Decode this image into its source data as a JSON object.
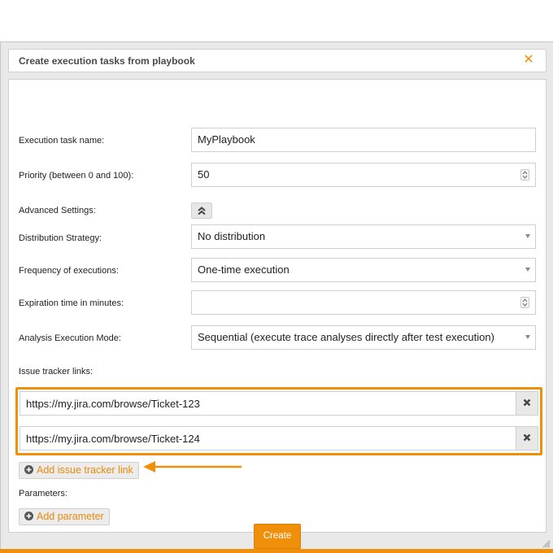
{
  "dialog": {
    "title": "Create execution tasks from playbook",
    "close_icon": "close-icon",
    "close_glyph": "✕"
  },
  "form": {
    "task_name": {
      "label": "Execution task name:",
      "value": "MyPlaybook"
    },
    "priority": {
      "label": "Priority (between 0 and 100):",
      "value": "50"
    },
    "advanced": {
      "label": "Advanced Settings:",
      "icon": "double-chevron-up-icon"
    },
    "distribution": {
      "label": "Distribution Strategy:",
      "value": "No distribution"
    },
    "frequency": {
      "label": "Frequency of executions:",
      "value": "One-time execution"
    },
    "expiration": {
      "label": "Expiration time in minutes:",
      "value": ""
    },
    "analysis_mode": {
      "label": "Analysis Execution Mode:",
      "value": "Sequential (execute trace analyses directly after test execution)"
    },
    "issue_tracker": {
      "label": "Issue tracker links:",
      "links": [
        {
          "url": "https://my.jira.com/browse/Ticket-123"
        },
        {
          "url": "https://my.jira.com/browse/Ticket-124"
        }
      ],
      "add_label": "Add issue tracker link"
    },
    "parameters": {
      "label": "Parameters:",
      "add_label": "Add parameter"
    },
    "create_label": "Create"
  },
  "colors": {
    "accent": "#f0900a",
    "add_text": "#e88a0c",
    "dialog_bg": "#e9e9e9"
  }
}
